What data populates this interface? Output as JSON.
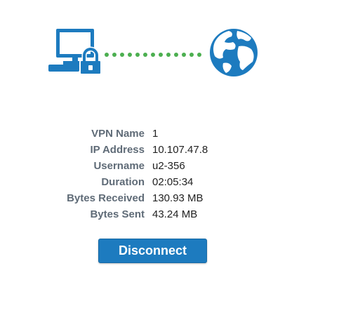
{
  "colors": {
    "brand_blue": "#1d7bbf",
    "connection_green": "#4caf50",
    "label_gray": "#5f6b77"
  },
  "graphic": {
    "left_icon": "computer-lock-icon",
    "connector": "dotted-connection-line",
    "right_icon": "globe-icon"
  },
  "connection_info": {
    "rows": [
      {
        "label": "VPN Name",
        "value": "1"
      },
      {
        "label": "IP Address",
        "value": "10.107.47.8"
      },
      {
        "label": "Username",
        "value": "u2-356"
      },
      {
        "label": "Duration",
        "value": "02:05:34"
      },
      {
        "label": "Bytes Received",
        "value": "130.93 MB"
      },
      {
        "label": "Bytes Sent",
        "value": "43.24 MB"
      }
    ]
  },
  "actions": {
    "disconnect_label": "Disconnect"
  }
}
